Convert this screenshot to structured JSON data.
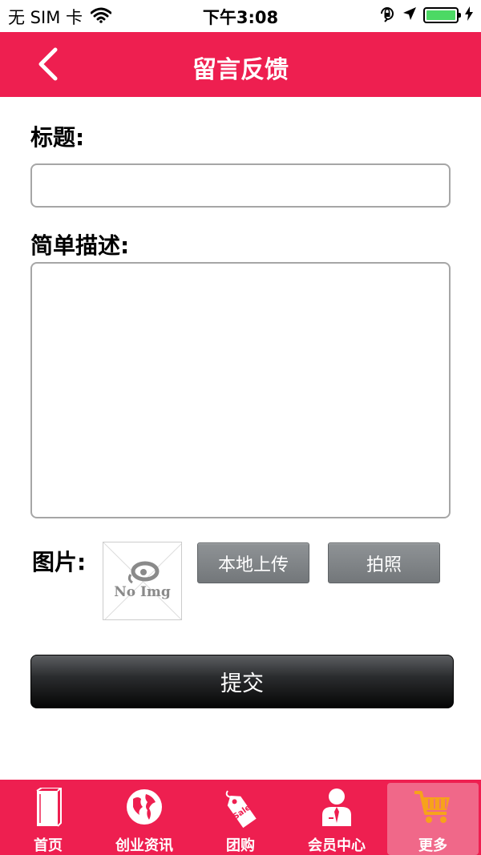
{
  "status_bar": {
    "carrier": "无 SIM 卡",
    "time": "下午3:08"
  },
  "nav": {
    "title": "留言反馈"
  },
  "form": {
    "title_label": "标题:",
    "title_value": "",
    "description_label": "简单描述:",
    "description_value": "",
    "image_label": "图片:",
    "no_image_text": "No Img",
    "local_upload_label": "本地上传",
    "take_photo_label": "拍照",
    "submit_label": "提交"
  },
  "tabs": [
    {
      "label": "首页",
      "icon": "book-icon"
    },
    {
      "label": "创业资讯",
      "icon": "globe-icon"
    },
    {
      "label": "团购",
      "icon": "sale-tag-icon"
    },
    {
      "label": "会员中心",
      "icon": "member-icon"
    },
    {
      "label": "更多",
      "icon": "cart-icon",
      "active": true
    }
  ],
  "colors": {
    "brand": "#ee1f50",
    "active_tab": "#f06889",
    "cart": "#f7a21b",
    "battery": "#4cd964"
  }
}
